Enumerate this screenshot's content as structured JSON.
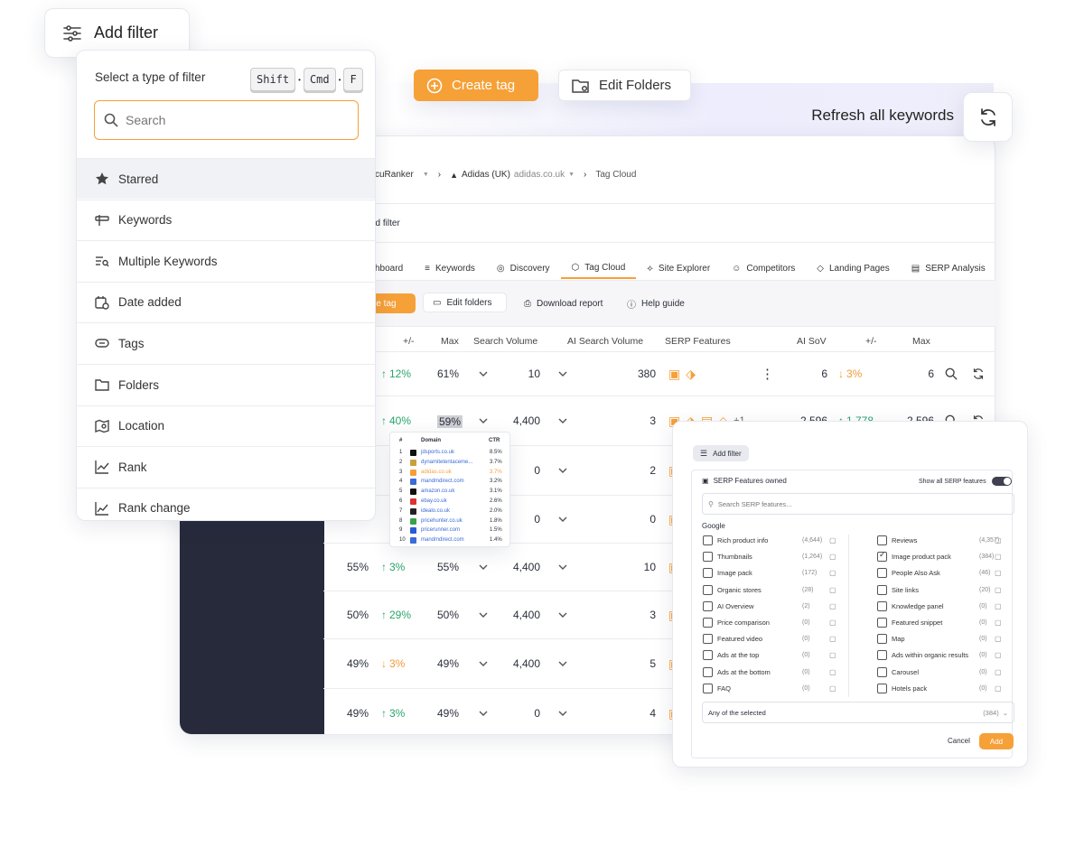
{
  "top_filter": {
    "label": "Add filter"
  },
  "toolbar": {
    "create_tag": "Create tag",
    "edit_folders": "Edit Folders",
    "refresh_label": "Refresh all keywords"
  },
  "filter_panel": {
    "title": "Select a type of filter",
    "shortcut": [
      "Shift",
      "Cmd",
      "F"
    ],
    "search_placeholder": "Search",
    "items": [
      {
        "label": "Starred",
        "icon": "star-icon"
      },
      {
        "label": "Keywords",
        "icon": "keywords-icon"
      },
      {
        "label": "Multiple Keywords",
        "icon": "multiple-keywords-icon"
      },
      {
        "label": "Date added",
        "icon": "calendar-icon"
      },
      {
        "label": "Tags",
        "icon": "tag-icon"
      },
      {
        "label": "Folders",
        "icon": "folder-icon"
      },
      {
        "label": "Location",
        "icon": "location-icon"
      },
      {
        "label": "Rank",
        "icon": "rank-chart-icon"
      },
      {
        "label": "Rank change",
        "icon": "rank-change-icon"
      }
    ]
  },
  "app": {
    "breadcrumb": {
      "root": "ccuRanker",
      "domain": "Adidas (UK)",
      "domain_url": "adidas.co.uk",
      "page": "Tag Cloud"
    },
    "add_filter": "dd filter",
    "tabs": [
      "shboard",
      "Keywords",
      "Discovery",
      "Tag Cloud",
      "Site Explorer",
      "Competitors",
      "Landing Pages",
      "SERP Analysis"
    ],
    "active_tab": "Tag Cloud",
    "actions": {
      "create_tag": "ate tag",
      "edit_folders": "Edit folders",
      "download": "Download report",
      "help": "Help guide"
    },
    "columns": [
      "+/-",
      "Max",
      "Search Volume",
      "AI Search Volume",
      "SERP Features",
      "AI SoV",
      "+/-",
      "Max"
    ],
    "rows": [
      {
        "share": "",
        "change": "12%",
        "dir": "up",
        "max": "61%",
        "sv": "10",
        "aisv": "380",
        "sov": "6",
        "sov_change": "3%",
        "sov_dir": "dn",
        "sov_max": "6"
      },
      {
        "share": "",
        "change": "40%",
        "dir": "up",
        "max": "59%",
        "sv": "4,400",
        "aisv": "3",
        "more": "+1",
        "sov": "2,596",
        "sov_change": "1,778",
        "sov_dir": "up",
        "sov_max": "2,596"
      },
      {
        "share": "",
        "change": "",
        "dir": "up",
        "max": "",
        "sv": "0",
        "aisv": "2"
      },
      {
        "share": "",
        "change": "",
        "dir": "up",
        "max": "",
        "sv": "0",
        "aisv": "0"
      },
      {
        "share": "55%",
        "change": "3%",
        "dir": "up",
        "max": "55%",
        "sv": "4,400",
        "aisv": "10"
      },
      {
        "share": "50%",
        "change": "29%",
        "dir": "up",
        "max": "50%",
        "sv": "4,400",
        "aisv": "3"
      },
      {
        "share": "49%",
        "change": "3%",
        "dir": "dn",
        "max": "49%",
        "sv": "4,400",
        "aisv": "5"
      },
      {
        "share": "49%",
        "change": "3%",
        "dir": "up",
        "max": "49%",
        "sv": "0",
        "aisv": "4"
      }
    ]
  },
  "domain_popup": {
    "headers": [
      "#",
      "Domain",
      "CTR"
    ],
    "rows": [
      [
        "1",
        "jdsports.co.uk",
        "8.5%"
      ],
      [
        "2",
        "dynamitetentaceme...",
        "3.7%"
      ],
      [
        "3",
        "adidas.co.uk",
        "3.7%"
      ],
      [
        "4",
        "mandmdirect.com",
        "3.2%"
      ],
      [
        "5",
        "amazon.co.uk",
        "3.1%"
      ],
      [
        "6",
        "ebay.co.uk",
        "2.6%"
      ],
      [
        "7",
        "idealo.co.uk",
        "2.0%"
      ],
      [
        "8",
        "pricehunter.co.uk",
        "1.8%"
      ],
      [
        "9",
        "pricerunner.com",
        "1.5%"
      ],
      [
        "10",
        "mandmdirect.com",
        "1.4%"
      ]
    ]
  },
  "serp_dialog": {
    "add_filter": "Add filter",
    "title": "SERP Features owned",
    "toggle_label": "Show all SERP features",
    "search_placeholder": "Search SERP features...",
    "group": "Google",
    "left": [
      {
        "label": "Rich product info",
        "count": "(4,644)",
        "checked": false
      },
      {
        "label": "Thumbnails",
        "count": "(1,264)",
        "checked": false
      },
      {
        "label": "Image pack",
        "count": "(172)",
        "checked": false
      },
      {
        "label": "Organic stores",
        "count": "(28)",
        "checked": false
      },
      {
        "label": "AI Overview",
        "count": "(2)",
        "checked": false
      },
      {
        "label": "Price comparison",
        "count": "(0)",
        "checked": false
      },
      {
        "label": "Featured video",
        "count": "(0)",
        "checked": false
      },
      {
        "label": "Ads at the top",
        "count": "(0)",
        "checked": false
      },
      {
        "label": "Ads at the bottom",
        "count": "(0)",
        "checked": false
      },
      {
        "label": "FAQ",
        "count": "(0)",
        "checked": false
      }
    ],
    "right": [
      {
        "label": "Reviews",
        "count": "(4,357)",
        "checked": false
      },
      {
        "label": "Image product pack",
        "count": "(384)",
        "checked": true
      },
      {
        "label": "People Also Ask",
        "count": "(46)",
        "checked": false
      },
      {
        "label": "Site links",
        "count": "(20)",
        "checked": false
      },
      {
        "label": "Knowledge panel",
        "count": "(0)",
        "checked": false
      },
      {
        "label": "Featured snippet",
        "count": "(0)",
        "checked": false
      },
      {
        "label": "Map",
        "count": "(0)",
        "checked": false
      },
      {
        "label": "Ads within organic results",
        "count": "(0)",
        "checked": false
      },
      {
        "label": "Carousel",
        "count": "(0)",
        "checked": false
      },
      {
        "label": "Hotels pack",
        "count": "(0)",
        "checked": false
      }
    ],
    "match_select": "Any of the selected",
    "match_count": "(384)",
    "cancel": "Cancel",
    "add": "Add"
  },
  "colors": {
    "accent": "#f6a038",
    "up": "#2aa56c",
    "down": "#f29a38",
    "sidebar": "#262a3b"
  }
}
